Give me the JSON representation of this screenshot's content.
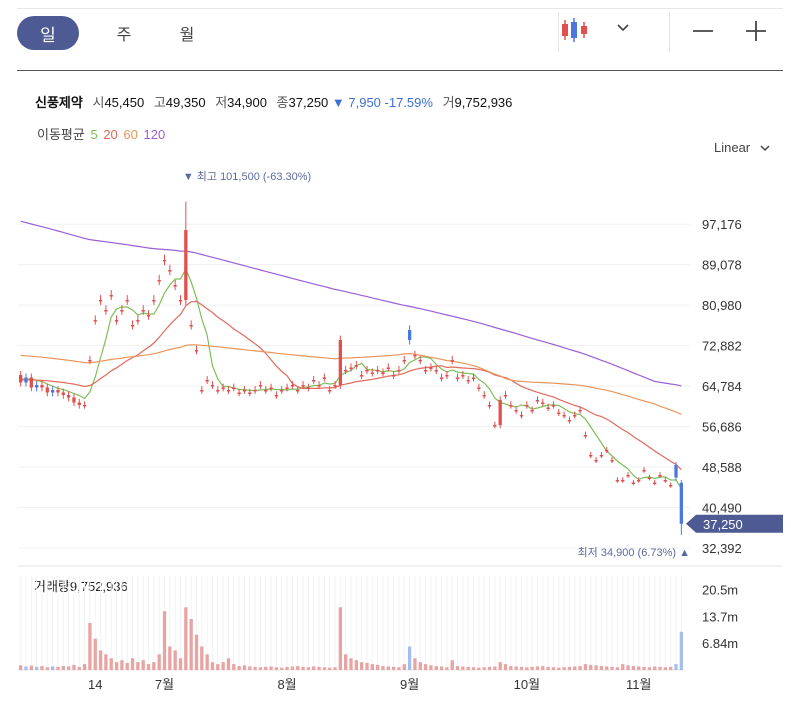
{
  "toolbar": {
    "periods": [
      "일",
      "주",
      "월"
    ],
    "selected_period": "일",
    "chart_type_icon": "candlestick-icon",
    "dropdown_icon": "chevron-down-icon",
    "zoom_out_icon": "minus-icon",
    "zoom_in_icon": "plus-icon",
    "accent": "#4d5a93"
  },
  "quote": {
    "name": "신풍제약",
    "open_label": "시",
    "open": "45,450",
    "high_label": "고",
    "high": "49,350",
    "low_label": "저",
    "low": "34,900",
    "close_label": "종",
    "close": "37,250",
    "change": "▼ 7,950 -17.59%",
    "volume_label": "거",
    "volume": "9,752,936"
  },
  "ma_legend": {
    "label": "이동평균",
    "items": [
      {
        "period": "5",
        "color": "#7cbf5a"
      },
      {
        "period": "20",
        "color": "#e06a5c"
      },
      {
        "period": "60",
        "color": "#e8955a"
      },
      {
        "period": "120",
        "color": "#9a5fd6"
      }
    ]
  },
  "scale": {
    "label": "Linear"
  },
  "chart_data": {
    "type": "candlestick",
    "colors": {
      "up": "#e0504e",
      "down": "#4a78dc",
      "vol_up": "#e8a3a3",
      "vol_down": "#a6bdf0",
      "price_tag": "#4d5a93"
    },
    "y_ticks": [
      97176,
      89078,
      80980,
      72882,
      64784,
      56686,
      48588,
      40490,
      32392
    ],
    "y_tick_labels": [
      "97,176",
      "89,078",
      "80,980",
      "72,882",
      "64,784",
      "56,686",
      "48,588",
      "40,490",
      "32,392"
    ],
    "x_labels": [
      {
        "label": "14",
        "index": 14
      },
      {
        "label": "7월",
        "index": 27
      },
      {
        "label": "8월",
        "index": 50
      },
      {
        "label": "9월",
        "index": 73
      },
      {
        "label": "10월",
        "index": 95
      },
      {
        "label": "11월",
        "index": 116
      }
    ],
    "current_price_label": "37,250",
    "high_annotation": "▼ 최고 101,500 (-63.30%)",
    "high_annotation_index": 31,
    "low_annotation": "최저 34,900 (6.73%) ▲",
    "volume_title": "거래량",
    "volume_value": "9,752,936",
    "volume_ticks": [
      {
        "label": "20.5m",
        "value": 20500000
      },
      {
        "label": "13.7m",
        "value": 13700000
      },
      {
        "label": "6.84m",
        "value": 6840000
      }
    ],
    "closes": [
      67000,
      65500,
      66500,
      64500,
      65000,
      64500,
      63500,
      64000,
      63500,
      63000,
      62500,
      61500,
      61000,
      70000,
      78000,
      82000,
      80000,
      83000,
      78000,
      80000,
      82000,
      77000,
      78000,
      80000,
      79000,
      82000,
      86000,
      90000,
      88000,
      85000,
      82000,
      96000,
      77000,
      72000,
      64000,
      66000,
      65000,
      64000,
      64500,
      64000,
      64500,
      63500,
      64000,
      63500,
      64000,
      65000,
      64000,
      64500,
      63000,
      64000,
      64500,
      65000,
      64000,
      65000,
      64500,
      66000,
      65000,
      66500,
      64000,
      65000,
      74000,
      68000,
      68500,
      69000,
      67000,
      68000,
      67500,
      68000,
      67500,
      68500,
      67000,
      68000,
      70000,
      74000,
      71000,
      70000,
      68000,
      68500,
      68000,
      66500,
      67000,
      70000,
      66500,
      67000,
      66000,
      66500,
      64500,
      63000,
      61000,
      57000,
      62000,
      63000,
      61000,
      60000,
      59000,
      61000,
      60000,
      62000,
      61500,
      60500,
      61000,
      59500,
      59000,
      58000,
      59000,
      60000,
      55000,
      51000,
      50000,
      51000,
      52000,
      50000,
      46000,
      46000,
      47000,
      45500,
      46000,
      48000,
      46500,
      45500,
      47000,
      46000,
      45000,
      46500,
      37250
    ],
    "opens": [
      65500,
      66500,
      64500,
      65000,
      64500,
      63500,
      64000,
      63500,
      63000,
      62500,
      61500,
      61000,
      61000,
      70000,
      78000,
      82000,
      80000,
      83000,
      78000,
      80000,
      82000,
      77000,
      78000,
      80000,
      79000,
      82000,
      86000,
      90000,
      88000,
      85000,
      82000,
      82000,
      77000,
      72000,
      64000,
      66000,
      65000,
      64000,
      64500,
      64000,
      64500,
      63500,
      64000,
      63500,
      64000,
      65000,
      64000,
      64500,
      63000,
      64000,
      64500,
      65000,
      64000,
      65000,
      64500,
      66000,
      65000,
      66500,
      64000,
      65000,
      65000,
      68000,
      68500,
      69000,
      67000,
      68000,
      67500,
      68000,
      67500,
      68500,
      67000,
      68000,
      70000,
      76000,
      71000,
      70000,
      68000,
      68500,
      68000,
      66500,
      67000,
      70000,
      66500,
      67000,
      66000,
      66500,
      64500,
      63000,
      61000,
      57000,
      57000,
      63000,
      61000,
      60000,
      59000,
      61000,
      60000,
      62000,
      61500,
      60500,
      61000,
      59500,
      59000,
      58000,
      59000,
      60000,
      55000,
      51000,
      50000,
      51000,
      52000,
      50000,
      46000,
      46000,
      47000,
      45500,
      46000,
      48000,
      46500,
      45500,
      47000,
      46000,
      45000,
      49000,
      45450
    ],
    "volumes": [
      1200000,
      900000,
      1100000,
      800000,
      1000000,
      700000,
      900000,
      800000,
      1000000,
      900000,
      1300000,
      800000,
      1500000,
      12000000,
      8000000,
      5000000,
      4000000,
      3000000,
      2000000,
      2500000,
      1800000,
      3000000,
      2000000,
      2500000,
      1500000,
      2000000,
      4000000,
      15000000,
      6000000,
      5000000,
      3000000,
      16000000,
      13000000,
      9000000,
      6000000,
      4000000,
      2000000,
      1500000,
      2000000,
      3000000,
      1500000,
      1000000,
      1200000,
      900000,
      800000,
      700000,
      800000,
      900000,
      700000,
      600000,
      800000,
      900000,
      1000000,
      800000,
      700000,
      900000,
      800000,
      700000,
      600000,
      700000,
      16000000,
      4000000,
      3000000,
      2500000,
      2000000,
      1800000,
      1500000,
      1300000,
      1000000,
      900000,
      800000,
      700000,
      1500000,
      6000000,
      3000000,
      2000000,
      1500000,
      1200000,
      1000000,
      900000,
      700000,
      2500000,
      1000000,
      900000,
      800000,
      700000,
      600000,
      700000,
      800000,
      900000,
      2000000,
      1500000,
      1000000,
      900000,
      800000,
      700000,
      800000,
      900000,
      1000000,
      800000,
      700000,
      600000,
      700000,
      800000,
      900000,
      1000000,
      1500000,
      1300000,
      1200000,
      1000000,
      900000,
      800000,
      700000,
      1500000,
      1200000,
      1000000,
      900000,
      800000,
      700000,
      900000,
      800000,
      700000,
      800000,
      1500000,
      9752936
    ]
  }
}
